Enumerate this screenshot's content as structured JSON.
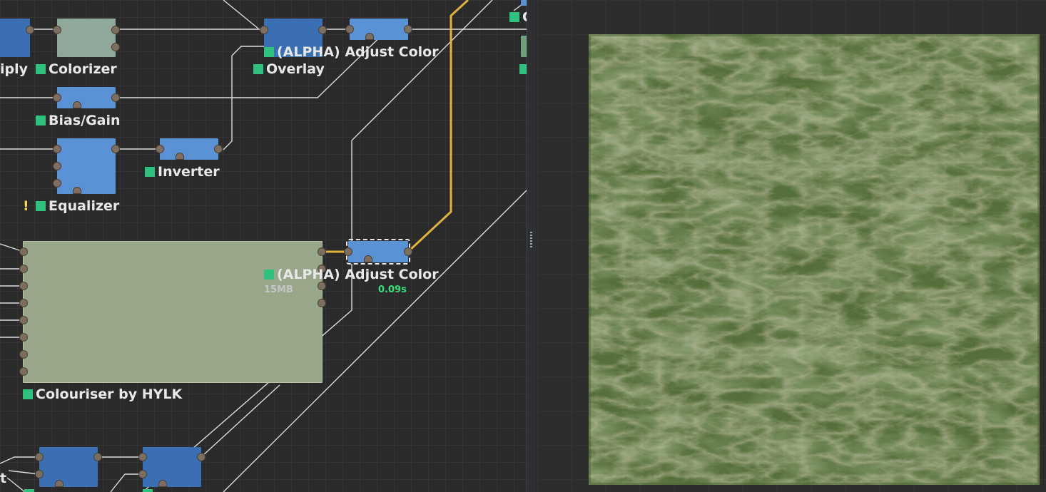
{
  "graph": {
    "nodes": {
      "multiply_label": "iply",
      "colorizer_label": "Colorizer",
      "overlay_label": "Overlay",
      "adjust_color_top_label": "(ALPHA) Adjust Color",
      "bias_gain_label": "Bias/Gain",
      "inverter_label": "Inverter",
      "equalizer_label": "Equalizer",
      "equalizer_warning": "!",
      "adjust_color_selected_label": "(ALPHA) Adjust Color",
      "adjust_color_selected_memory": "15MB",
      "adjust_color_selected_time": "0.09s",
      "colouriser_label": "Colouriser by HYLK",
      "bottom_left_fragment": "t",
      "top_right_fragment": "C"
    },
    "colors": {
      "node_dark": "#3b6fb4",
      "node_light": "#5b92d6",
      "node_green": "#8fa899",
      "node_olive": "#98a68a",
      "status_square": "#2ec27e",
      "selected_wire": "#e0b33a",
      "wire": "#dcdcdc",
      "time_text": "#38e07b",
      "warning": "#f2d74e"
    }
  },
  "preview": {
    "colors": {
      "terrain_base": "#556f3a",
      "terrain_ridge": "#8d8b64"
    }
  }
}
